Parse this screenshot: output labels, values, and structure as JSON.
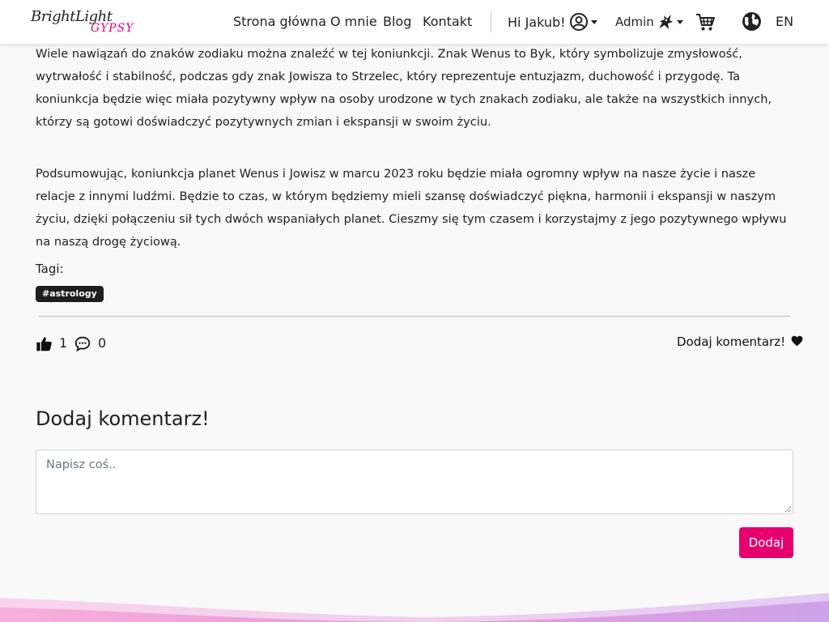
{
  "nav": {
    "logo_line1": "BrightLight",
    "logo_line2": "GYPSY",
    "links": [
      "Strona główna",
      "O mnie",
      "Blog",
      "Kontakt"
    ],
    "greeting": "Hi Jakub!",
    "admin_label": "Admin",
    "language": "EN",
    "icons": [
      "user-circle-icon",
      "dragon-icon",
      "cart-icon",
      "globe-icon"
    ]
  },
  "article": {
    "paragraphs": [
      "Wiele nawiązań do znaków zodiaku można znaleźć w tej koniunkcji. Znak Wenus to Byk, który symbolizuje zmysłowość, wytrwałość i stabilność, podczas gdy znak Jowisza to Strzelec, który reprezentuje entuzjazm, duchowość i przygodę. Ta koniunkcja będzie więc miała pozytywny wpływ na osoby urodzone w tych znakach zodiaku, ale także na wszystkich innych, którzy są gotowi doświadczyć pozytywnych zmian i ekspansji w swoim życiu.",
      "Podsumowując, koniunkcja planet Wenus i Jowisz w marcu 2023 roku będzie miała ogromny wpływ na nasze życie i nasze relacje z innymi ludźmi. Będzie to czas, w którym będziemy mieli szansę doświadczyć piękna, harmonii i ekspansji w naszym życiu, dzięki połączeniu sił tych dwóch wspaniałych planet. Cieszmy się tym czasem i korzystajmy z jego pozytywnego wpływu na naszą drogę życiową."
    ],
    "tags_label": "Tagi:",
    "tags": [
      "#astrology"
    ]
  },
  "stats": {
    "likes": "1",
    "comments": "0",
    "add_comment_link": "Dodaj komentarz!"
  },
  "comment_form": {
    "title": "Dodaj komentarz!",
    "placeholder": "Napisz coś..",
    "value": "",
    "submit_label": "Dodaj"
  },
  "colors": {
    "accent": "#e6006e",
    "tag_bg": "#1e1e1e",
    "page_bg": "#f9f9fa",
    "footer_wave_pink": "#f07ec8",
    "footer_wave_purple": "#b57ee0"
  }
}
